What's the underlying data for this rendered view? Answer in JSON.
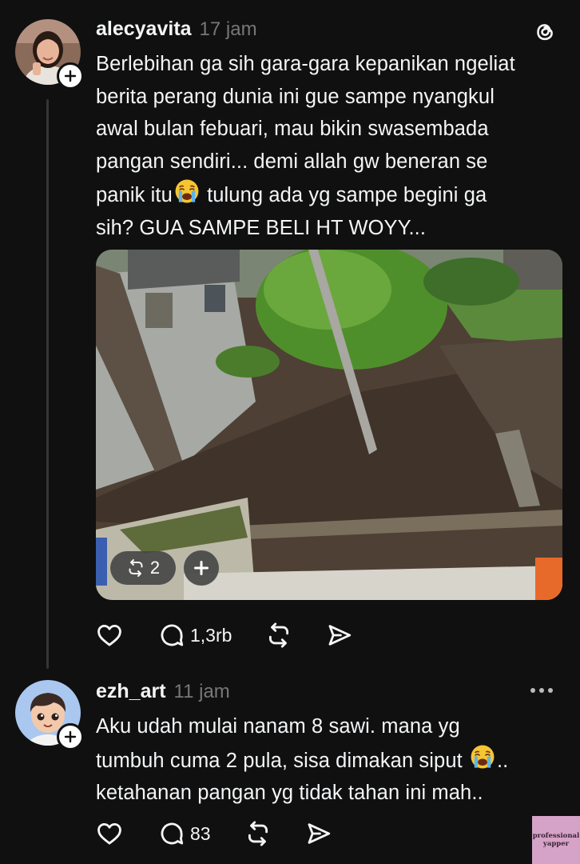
{
  "post1": {
    "username": "alecyavita",
    "time": "17 jam",
    "text_lines": [
      "Berlebihan ga sih gara-gara kepanikan ngeliat",
      "berita perang dunia ini gue sampe nyangkul",
      "awal bulan febuari, mau bikin swasembada",
      "pangan sendiri... demi allah gw beneran se",
      "panik itu",
      " tulung ada yg sampe begini ga",
      "sih? GUA SAMPE BELI HT WOYY..."
    ],
    "repost_count": "2",
    "reply_count": "1,3rb",
    "icons": [
      "threads-logo-icon",
      "follow-plus-icon",
      "heart-icon",
      "comment-icon",
      "repost-icon",
      "share-icon",
      "crying-face-emoji"
    ]
  },
  "post2": {
    "username": "ezh_art",
    "time": "11 jam",
    "text_lines": [
      "Aku udah mulai nanam 8 sawi. mana yg",
      "tumbuh cuma 2 pula, sisa dimakan siput ",
      "..",
      "ketahanan pangan yg tidak tahan ini mah.."
    ],
    "reply_count": "83",
    "icons": [
      "more-options-icon",
      "follow-plus-icon",
      "heart-icon",
      "comment-icon",
      "repost-icon",
      "share-icon",
      "crying-face-emoji"
    ]
  },
  "watermark": {
    "line1": "professional",
    "line2": "yapper"
  },
  "colors": {
    "background": "#101010",
    "text": "#f3f5f7",
    "muted": "#777777",
    "thread_line": "#333638",
    "watermark_bg": "#d6a3c8"
  }
}
